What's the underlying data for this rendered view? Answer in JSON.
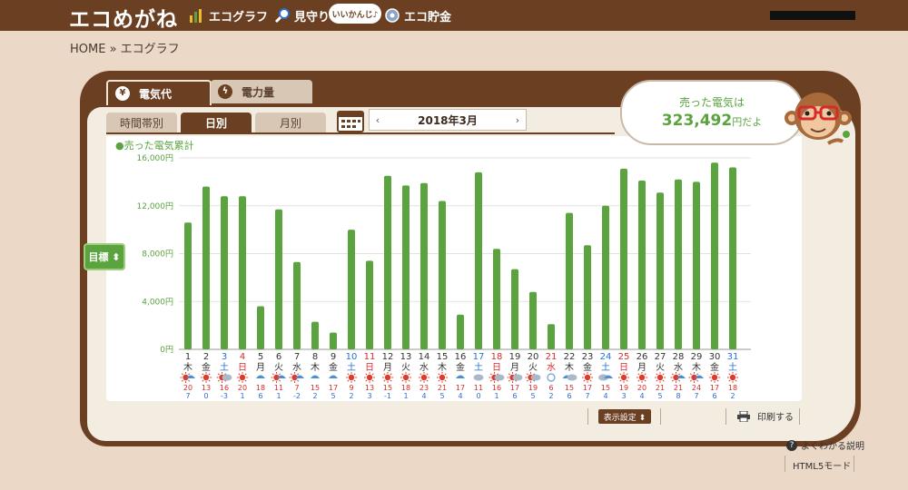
{
  "header": {
    "logo": "エコめがね",
    "nav": [
      {
        "label": "エコグラフ",
        "icon": "bar-graph-icon"
      },
      {
        "label": "見守り",
        "icon": "magnifier-icon"
      },
      {
        "label": "エコ貯金",
        "icon": "piggy-bank-icon"
      }
    ],
    "bubble": "いいかんじ♪"
  },
  "breadcrumb": "HOME » エコグラフ",
  "main_tabs": [
    {
      "label": "電気代",
      "icon": "yen-icon",
      "active": true
    },
    {
      "label": "電力量",
      "icon": "lightning-icon",
      "active": false
    }
  ],
  "sub_tabs": [
    {
      "label": "時間帯別",
      "active": false
    },
    {
      "label": "日別",
      "active": true
    },
    {
      "label": "月別",
      "active": false
    }
  ],
  "month": {
    "label": "2018年3月",
    "prev": "‹",
    "next": "›"
  },
  "goal_button": "目標 ⬍",
  "sold": {
    "line1": "売った電気は",
    "value": "323,492",
    "unit": "円だよ"
  },
  "display_settings": "表示設定 ⬍",
  "print": "印刷する",
  "help": "よくわかる説明",
  "html5": "HTML5モード",
  "colors": {
    "brown": "#6b3f22",
    "green": "#5aa33f",
    "blue": "#2a6fd6",
    "red": "#d62b2b"
  },
  "chart_data": {
    "type": "bar",
    "title": "●売った電気累計",
    "ylim": [
      0,
      16000
    ],
    "yticks": [
      "0円",
      "4,000円",
      "8,000円",
      "12,000円",
      "16,000円"
    ],
    "ytick_values": [
      0,
      4000,
      8000,
      12000,
      16000
    ],
    "days": [
      "1",
      "2",
      "3",
      "4",
      "5",
      "6",
      "7",
      "8",
      "9",
      "10",
      "11",
      "12",
      "13",
      "14",
      "15",
      "16",
      "17",
      "18",
      "19",
      "20",
      "21",
      "22",
      "23",
      "24",
      "25",
      "26",
      "27",
      "28",
      "29",
      "30",
      "31"
    ],
    "weekdays": [
      "木",
      "金",
      "土",
      "日",
      "月",
      "火",
      "水",
      "木",
      "金",
      "土",
      "日",
      "月",
      "火",
      "水",
      "木",
      "金",
      "土",
      "日",
      "月",
      "火",
      "水",
      "木",
      "金",
      "土",
      "日",
      "月",
      "火",
      "水",
      "木",
      "金",
      "土"
    ],
    "day_colors": [
      "k",
      "k",
      "b",
      "r",
      "k",
      "k",
      "k",
      "k",
      "k",
      "b",
      "r",
      "k",
      "k",
      "k",
      "k",
      "k",
      "b",
      "r",
      "k",
      "k",
      "r",
      "k",
      "k",
      "b",
      "r",
      "k",
      "k",
      "k",
      "k",
      "k",
      "b"
    ],
    "values": [
      10600,
      13600,
      12800,
      12800,
      3600,
      11700,
      7300,
      2300,
      1400,
      10000,
      7400,
      14500,
      13700,
      13900,
      12400,
      2900,
      14800,
      8400,
      6700,
      4800,
      2100,
      11400,
      8700,
      12000,
      15100,
      14100,
      13100,
      14200,
      14000,
      15600,
      15200
    ],
    "weather": [
      "sun-rain",
      "sun",
      "sun-cloud",
      "sun",
      "rain",
      "sun-rain",
      "sun-rain",
      "rain",
      "rain",
      "sun",
      "sun",
      "sun",
      "sun",
      "sun",
      "sun",
      "rain",
      "cloud",
      "sun-cloud",
      "sun-cloud",
      "sun-cloud",
      "snow",
      "rain-cloud",
      "sun",
      "cloud-rain",
      "sun",
      "sun",
      "sun",
      "sun-rain",
      "sun-rain",
      "sun",
      "sun"
    ],
    "temp_high": [
      "20",
      "13",
      "16",
      "20",
      "18",
      "11",
      "7",
      "15",
      "17",
      "9",
      "13",
      "15",
      "18",
      "23",
      "21",
      "17",
      "11",
      "16",
      "17",
      "19",
      "6",
      "15",
      "17",
      "15",
      "19",
      "20",
      "21",
      "21",
      "24",
      "17",
      "18"
    ],
    "temp_low": [
      "7",
      "0",
      "-3",
      "1",
      "6",
      "1",
      "-2",
      "2",
      "5",
      "2",
      "3",
      "-1",
      "1",
      "4",
      "5",
      "4",
      "0",
      "1",
      "6",
      "5",
      "2",
      "6",
      "7",
      "4",
      "3",
      "4",
      "5",
      "8",
      "7",
      "6",
      "2"
    ]
  }
}
